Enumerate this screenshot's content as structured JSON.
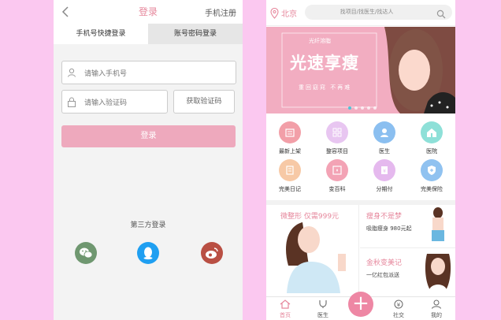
{
  "login": {
    "title": "登录",
    "register_link": "手机注册",
    "tabs": [
      "手机号快捷登录",
      "账号密码登录"
    ],
    "phone_placeholder": "请输入手机号",
    "code_placeholder": "请输入验证码",
    "get_code_label": "获取验证码",
    "login_button": "登录",
    "third_party_title": "第三方登录",
    "third_party": [
      "wechat-icon",
      "qq-icon",
      "weibo-icon"
    ],
    "colors": {
      "accent": "#e6879c",
      "button": "#eea9bd"
    }
  },
  "home": {
    "city": "北京",
    "search_placeholder": "找项目/找医生/找达人",
    "banner": {
      "tag": "光纤溶脂",
      "headline": "光速享瘦",
      "sub": "重回窈窕 不再难"
    },
    "grid": [
      {
        "label": "最新上架",
        "icon": "new-icon",
        "color": "#f29fa8"
      },
      {
        "label": "整容项目",
        "icon": "grid-icon",
        "color": "#e8c6f1"
      },
      {
        "label": "医生",
        "icon": "doctor-icon",
        "color": "#8bbff0"
      },
      {
        "label": "医院",
        "icon": "hospital-icon",
        "color": "#8ee0d8"
      },
      {
        "label": "完美日记",
        "icon": "diary-icon",
        "color": "#f7c9a6"
      },
      {
        "label": "变百科",
        "icon": "wiki-icon",
        "color": "#f3a3b5"
      },
      {
        "label": "分期付",
        "icon": "installment-icon",
        "color": "#e5b9ee"
      },
      {
        "label": "完美保险",
        "icon": "insurance-icon",
        "color": "#90c2f0"
      }
    ],
    "promo": {
      "left_title": "微整形 仅需999元",
      "right_top_title": "瘦身不是梦",
      "right_top_sub": "吸脂瘦身 980元起",
      "right_bottom_title": "金秋变美记",
      "right_bottom_sub": "一亿红包派送"
    },
    "tabbar": [
      "首页",
      "医生",
      "",
      "社交",
      "我的"
    ]
  }
}
